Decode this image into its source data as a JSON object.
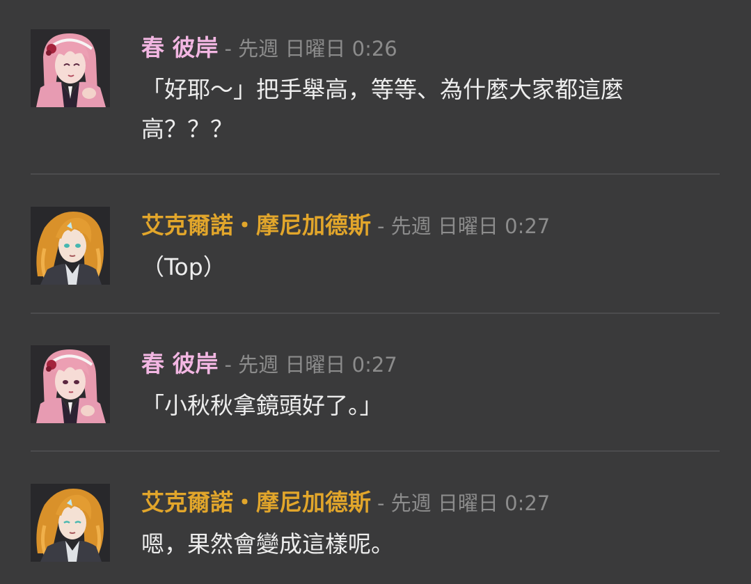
{
  "colors": {
    "background": "#3a3a3b",
    "author_pink": "#f2b6e2",
    "author_gold": "#e2a62b",
    "meta_text": "#8c8c8c",
    "body_text": "#ededed",
    "divider": "#4c4c4e"
  },
  "messages": [
    {
      "author": "春 彼岸",
      "meta": "- 先週 日曜日 0:26",
      "text": "「好耶～」把手舉高，等等、為什麼大家都這麼高？？？",
      "avatar": "pink-haired-character-avatar"
    },
    {
      "author": "艾克爾諾・摩尼加德斯",
      "meta": "- 先週 日曜日 0:27",
      "text": "（Top）",
      "avatar": "orange-haired-character-avatar"
    },
    {
      "author": "春 彼岸",
      "meta": "- 先週 日曜日 0:27",
      "text": "「小秋秋拿鏡頭好了。」",
      "avatar": "pink-haired-character-avatar"
    },
    {
      "author": "艾克爾諾・摩尼加德斯",
      "meta": "- 先週 日曜日 0:27",
      "text": "嗯，果然會變成這樣呢。",
      "avatar": "orange-haired-character-avatar"
    }
  ]
}
